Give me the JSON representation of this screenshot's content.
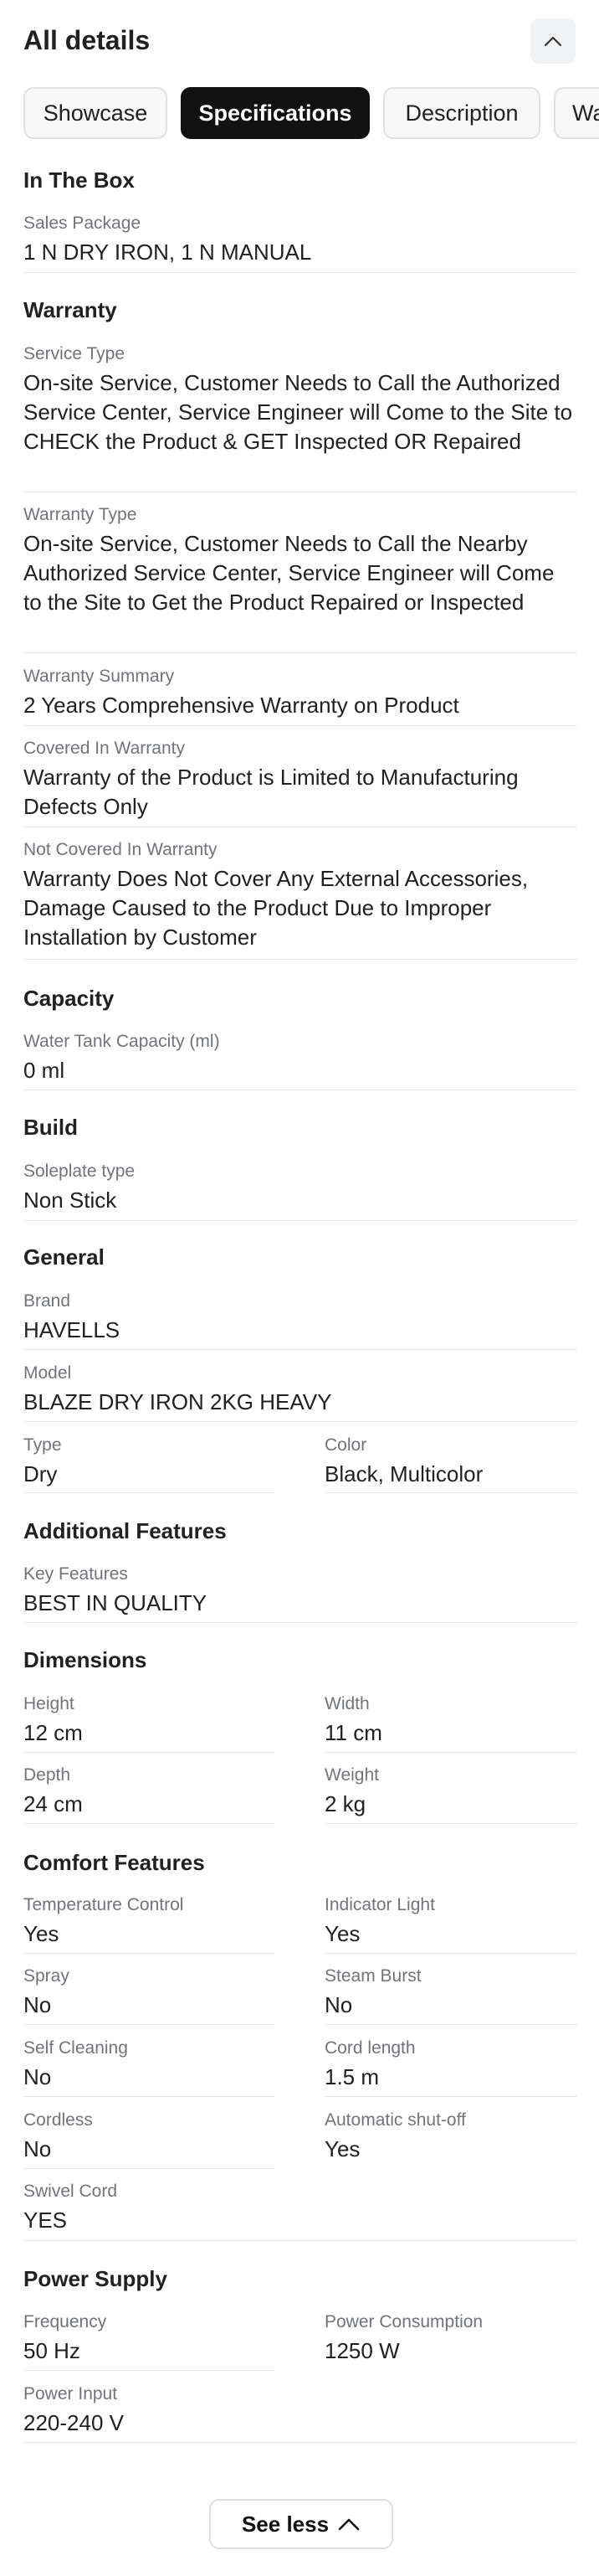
{
  "header": {
    "title": "All details"
  },
  "tabs": [
    "Showcase",
    "Specifications",
    "Description",
    "Warranty"
  ],
  "active_tab": "Specifications",
  "sections": {
    "in_the_box": {
      "title": "In The Box",
      "sales_package": {
        "label": "Sales Package",
        "value": "1 N DRY IRON, 1 N MANUAL"
      }
    },
    "warranty": {
      "title": "Warranty",
      "service_type": {
        "label": "Service Type",
        "value": "On-site Service, Customer Needs to Call the Authorized Service Center, Service Engineer will Come to the Site to CHECK the Product & GET Inspected OR Repaired"
      },
      "warranty_type": {
        "label": "Warranty Type",
        "value": "On-site Service, Customer Needs to Call the Nearby Authorized Service Center, Service Engineer will Come to the Site to Get the Product Repaired or Inspected"
      },
      "warranty_summary": {
        "label": "Warranty Summary",
        "value": "2 Years Comprehensive Warranty on Product"
      },
      "covered": {
        "label": "Covered In Warranty",
        "value": "Warranty of the Product is Limited to Manufacturing Defects Only"
      },
      "not_covered": {
        "label": "Not Covered In Warranty",
        "value": "Warranty Does Not Cover Any External Accessories, Damage Caused to the Product Due to Improper Installation by Customer"
      }
    },
    "capacity": {
      "title": "Capacity",
      "water_tank": {
        "label": "Water Tank Capacity (ml)",
        "value": "0 ml"
      }
    },
    "build": {
      "title": "Build",
      "soleplate": {
        "label": "Soleplate type",
        "value": "Non Stick"
      }
    },
    "general": {
      "title": "General",
      "brand": {
        "label": "Brand",
        "value": "HAVELLS"
      },
      "model": {
        "label": "Model",
        "value": "BLAZE DRY IRON 2KG HEAVY"
      },
      "type": {
        "label": "Type",
        "value": "Dry"
      },
      "color": {
        "label": "Color",
        "value": "Black, Multicolor"
      }
    },
    "additional": {
      "title": "Additional Features",
      "key_features": {
        "label": "Key Features",
        "value": "BEST IN QUALITY"
      }
    },
    "dimensions": {
      "title": "Dimensions",
      "height": {
        "label": "Height",
        "value": "12 cm"
      },
      "width": {
        "label": "Width",
        "value": "11 cm"
      },
      "depth": {
        "label": "Depth",
        "value": "24 cm"
      },
      "weight": {
        "label": "Weight",
        "value": "2 kg"
      }
    },
    "comfort": {
      "title": "Comfort Features",
      "temperature_control": {
        "label": "Temperature Control",
        "value": "Yes"
      },
      "indicator_light": {
        "label": "Indicator Light",
        "value": "Yes"
      },
      "spray": {
        "label": "Spray",
        "value": "No"
      },
      "steam_burst": {
        "label": "Steam Burst",
        "value": "No"
      },
      "self_cleaning": {
        "label": "Self Cleaning",
        "value": "No"
      },
      "cord_length": {
        "label": "Cord length",
        "value": "1.5 m"
      },
      "cordless": {
        "label": "Cordless",
        "value": "No"
      },
      "auto_shutoff": {
        "label": "Automatic shut-off",
        "value": "Yes"
      },
      "swivel_cord": {
        "label": "Swivel Cord",
        "value": "YES"
      }
    },
    "power": {
      "title": "Power Supply",
      "frequency": {
        "label": "Frequency",
        "value": "50 Hz"
      },
      "consumption": {
        "label": "Power Consumption",
        "value": "1250 W"
      },
      "input": {
        "label": "Power Input",
        "value": "220-240 V"
      }
    }
  },
  "footer": {
    "see_less_label": "See less"
  }
}
